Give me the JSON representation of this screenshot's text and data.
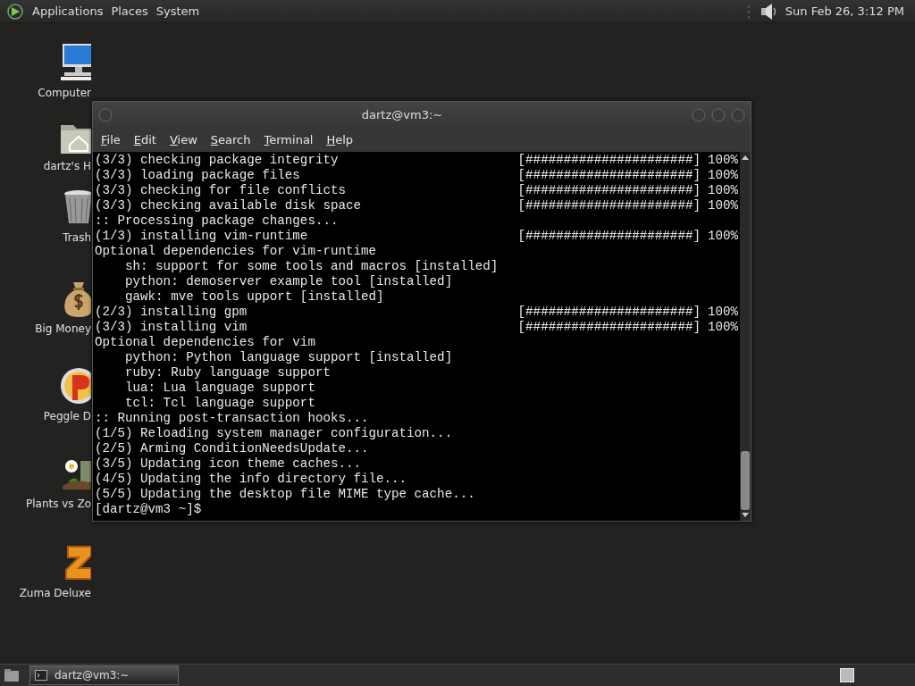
{
  "top_panel": {
    "menus": [
      "Applications",
      "Places",
      "System"
    ],
    "clock": "Sun Feb 26,  3:12 PM"
  },
  "desktop_icons": [
    {
      "kind": "computer",
      "label": "Computer"
    },
    {
      "kind": "home",
      "label": "dartz's H"
    },
    {
      "kind": "trash",
      "label": "Trash"
    },
    {
      "kind": "money",
      "label": "Big Money"
    },
    {
      "kind": "peggle",
      "label": "Peggle D"
    },
    {
      "kind": "plants",
      "label": "Plants vs Zo"
    },
    {
      "kind": "zuma",
      "label": "Zuma Deluxe"
    }
  ],
  "window": {
    "title": "dartz@vm3:~",
    "menu": [
      "File",
      "Edit",
      "View",
      "Search",
      "Terminal",
      "Help"
    ],
    "lines": [
      {
        "text": "(3/3) checking package integrity",
        "bar": "[######################]",
        "percent": "100%"
      },
      {
        "text": "(3/3) loading package files",
        "bar": "[######################]",
        "percent": "100%"
      },
      {
        "text": "(3/3) checking for file conflicts",
        "bar": "[######################]",
        "percent": "100%"
      },
      {
        "text": "(3/3) checking available disk space",
        "bar": "[######################]",
        "percent": "100%"
      },
      {
        "text": ":: Processing package changes..."
      },
      {
        "text": "(1/3) installing vim-runtime",
        "bar": "[######################]",
        "percent": "100%"
      },
      {
        "text": "Optional dependencies for vim-runtime"
      },
      {
        "text": "    sh: support for some tools and macros [installed]"
      },
      {
        "text": "    python: demoserver example tool [installed]"
      },
      {
        "text": "    gawk: mve tools upport [installed]"
      },
      {
        "text": "(2/3) installing gpm",
        "bar": "[######################]",
        "percent": "100%"
      },
      {
        "text": "(3/3) installing vim",
        "bar": "[######################]",
        "percent": "100%"
      },
      {
        "text": "Optional dependencies for vim"
      },
      {
        "text": "    python: Python language support [installed]"
      },
      {
        "text": "    ruby: Ruby language support"
      },
      {
        "text": "    lua: Lua language support"
      },
      {
        "text": "    tcl: Tcl language support"
      },
      {
        "text": ":: Running post-transaction hooks..."
      },
      {
        "text": "(1/5) Reloading system manager configuration..."
      },
      {
        "text": "(2/5) Arming ConditionNeedsUpdate..."
      },
      {
        "text": "(3/5) Updating icon theme caches..."
      },
      {
        "text": "(4/5) Updating the info directory file..."
      },
      {
        "text": "(5/5) Updating the desktop file MIME type cache..."
      },
      {
        "text": "[dartz@vm3 ~]$"
      }
    ]
  },
  "taskbar": {
    "tasks": [
      {
        "label": "dartz@vm3:~",
        "selected": true
      }
    ]
  }
}
